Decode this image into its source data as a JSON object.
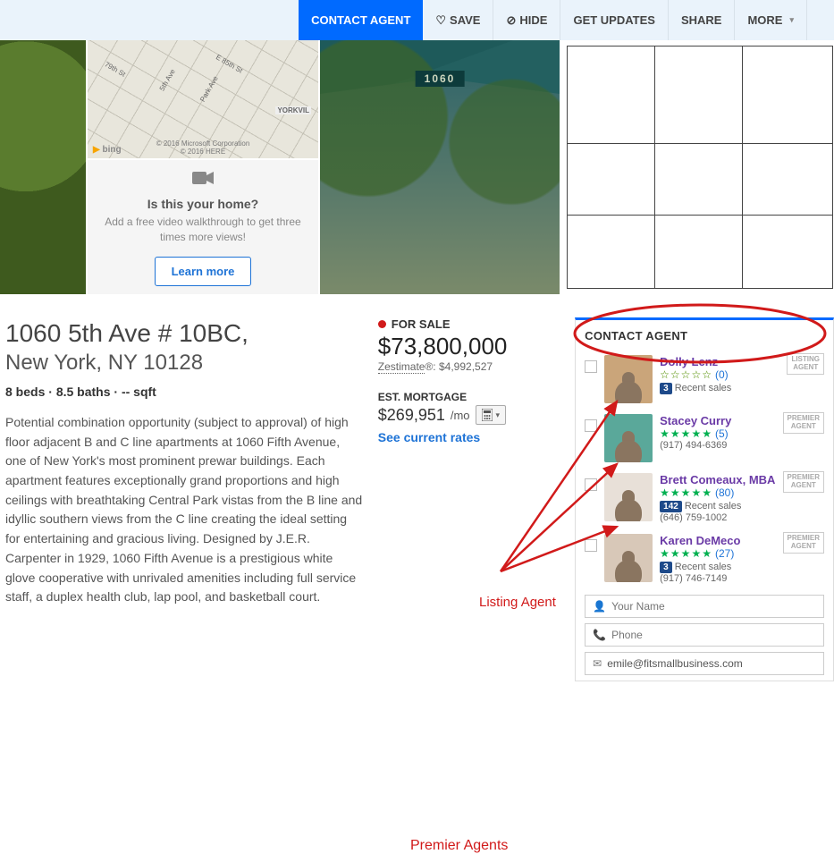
{
  "topbar": {
    "contact": "CONTACT AGENT",
    "save": "SAVE",
    "hide": "HIDE",
    "updates": "GET UPDATES",
    "share": "SHARE",
    "more": "MORE"
  },
  "map": {
    "street1": "79th St",
    "street2": "5th Ave",
    "street3": "Park Ave",
    "street4": "E 85th St",
    "district": "YORKVIL",
    "bing": "bing",
    "credit1": "© 2016 Microsoft Corporation",
    "credit2": "© 2016 HERE"
  },
  "panel": {
    "title": "Is this your home?",
    "sub": "Add a free video walkthrough to get three times more views!",
    "btn": "Learn more"
  },
  "listing": {
    "title": "1060 5th Ave # 10BC,",
    "subtitle": "New York, NY 10128",
    "beds_label": "8 beds",
    "baths_label": "8.5 baths",
    "sqft_label": "-- sqft",
    "description": "Potential combination opportunity (subject to approval) of high floor adjacent B and C line apartments at 1060 Fifth Avenue, one of New York's most prominent prewar buildings. Each apartment features exceptionally grand proportions and high ceilings with breathtaking Central Park vistas from the B line and idyllic southern views from the C line creating the ideal setting for entertaining and gracious living. Designed by J.E.R. Carpenter in 1929, 1060 Fifth Avenue is a prestigious white glove cooperative with unrivaled amenities including full service staff, a duplex health club, lap pool, and basketball court."
  },
  "pricing": {
    "status": "FOR SALE",
    "price": "$73,800,000",
    "zest_label": "Zestimate",
    "zest_suffix": "®:",
    "zest_value": "$4,992,527",
    "est_label": "EST. MORTGAGE",
    "est_value": "$269,951",
    "est_unit": "/mo",
    "rates": "See current rates"
  },
  "contactPanel": {
    "title": "CONTACT AGENT",
    "listing_tag": "LISTING AGENT",
    "premier_tag": "PREMIER AGENT",
    "agents": [
      {
        "name": "Dolly Lenz",
        "reviews": "(0)",
        "sales_badge": "3",
        "sales_text": "Recent sales",
        "phone": "",
        "filled": 0,
        "outline": true
      },
      {
        "name": "Stacey Curry",
        "reviews": "(5)",
        "sales_badge": "",
        "sales_text": "",
        "phone": "(917) 494-6369",
        "filled": 5,
        "outline": false
      },
      {
        "name": "Brett Comeaux, MBA",
        "reviews": "(80)",
        "sales_badge": "142",
        "sales_text": "Recent sales",
        "phone": "(646) 759-1002",
        "filled": 5,
        "outline": false
      },
      {
        "name": "Karen DeMeco",
        "reviews": "(27)",
        "sales_badge": "3",
        "sales_text": "Recent sales",
        "phone": "(917) 746-7149",
        "filled": 5,
        "outline": false
      }
    ],
    "name_placeholder": "Your Name",
    "phone_placeholder": "Phone",
    "email_value": "emile@fitsmallbusiness.com"
  },
  "annotations": {
    "listing_agent": "Listing Agent",
    "premier_agents": "Premier Agents"
  }
}
